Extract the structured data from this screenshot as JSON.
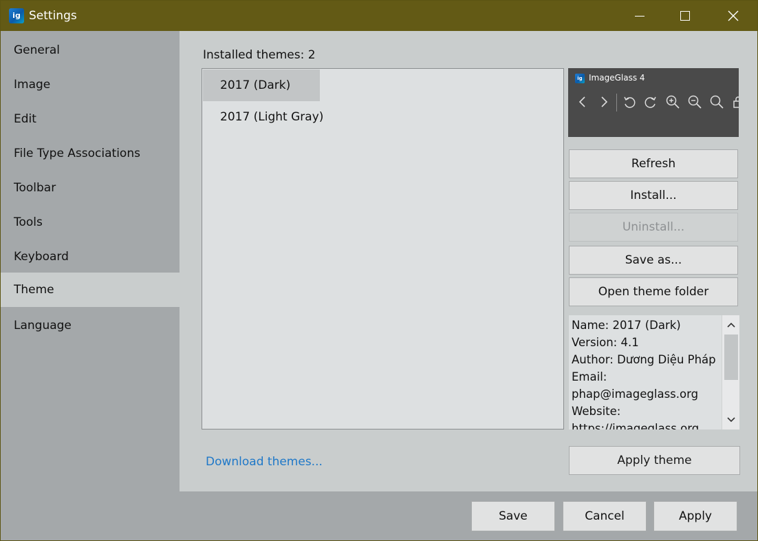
{
  "window": {
    "title": "Settings",
    "app_icon_text": "ig",
    "controls": [
      "minimize-icon",
      "maximize-icon",
      "close-icon"
    ],
    "title_bar_color": "#635a15"
  },
  "sidebar": {
    "items": [
      {
        "label": "General"
      },
      {
        "label": "Image"
      },
      {
        "label": "Edit"
      },
      {
        "label": "File Type Associations"
      },
      {
        "label": "Toolbar"
      },
      {
        "label": "Tools"
      },
      {
        "label": "Keyboard"
      },
      {
        "label": "Theme",
        "active": true
      },
      {
        "label": "Language"
      }
    ]
  },
  "theme_page": {
    "installed_label": "Installed themes: 2",
    "themes": [
      {
        "name": "2017 (Dark)",
        "selected": true
      },
      {
        "name": "2017 (Light Gray)",
        "selected": false
      }
    ],
    "preview": {
      "title": "ImageGlass 4",
      "logo_text": "ig",
      "tools": [
        "chevron-left-icon",
        "chevron-right-icon",
        "rotate-left-icon",
        "rotate-right-icon",
        "zoom-in-icon",
        "zoom-out-icon",
        "search-icon",
        "lock-icon"
      ]
    },
    "buttons": {
      "refresh": "Refresh",
      "install": "Install...",
      "uninstall": "Uninstall...",
      "save_as": "Save as...",
      "open_folder": "Open theme folder",
      "apply_theme": "Apply theme"
    },
    "info_lines": [
      "Name: 2017 (Dark)",
      "Version: 4.1",
      "Author: Dương Diệu Pháp",
      "Email:",
      "phap@imageglass.org",
      "Website:",
      "https://imageglass.org"
    ],
    "download_link": "Download themes..."
  },
  "footer": {
    "save": "Save",
    "cancel": "Cancel",
    "apply": "Apply"
  },
  "colors": {
    "link": "#1f78c8",
    "sidebar_bg": "#a4a8aa",
    "content_bg": "#c9cdcd"
  }
}
